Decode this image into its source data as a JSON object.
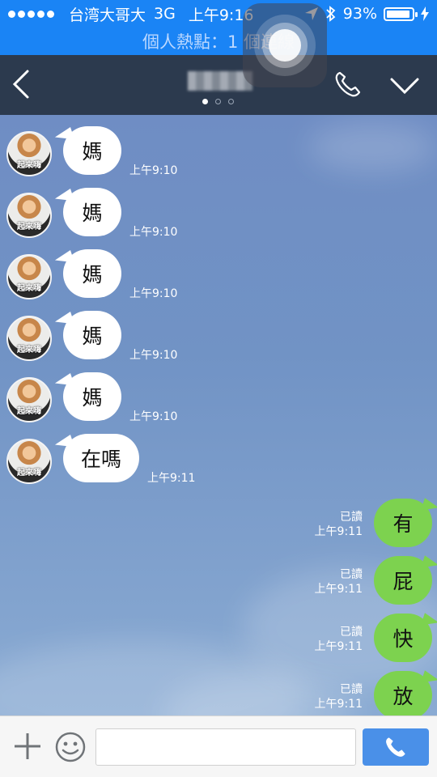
{
  "status_bar": {
    "carrier": "台湾大哥大",
    "network": "3G",
    "time": "上午9:16",
    "battery_percent": "93%",
    "battery_level": 0.93
  },
  "hotspot_bar": {
    "text": "個人熱點：1 個連線"
  },
  "header": {
    "page_count": 3,
    "active_page": 1
  },
  "incoming": [
    {
      "text": "媽",
      "time": "上午9:10",
      "avatar_caption": "起來嗨"
    },
    {
      "text": "媽",
      "time": "上午9:10",
      "avatar_caption": "起來嗨"
    },
    {
      "text": "媽",
      "time": "上午9:10",
      "avatar_caption": "起來嗨"
    },
    {
      "text": "媽",
      "time": "上午9:10",
      "avatar_caption": "起來嗨"
    },
    {
      "text": "媽",
      "time": "上午9:10",
      "avatar_caption": "起來嗨"
    },
    {
      "text": "在嗎",
      "time": "上午9:11",
      "avatar_caption": "起來嗨"
    }
  ],
  "outgoing": [
    {
      "text": "有",
      "read": "已讀",
      "time": "上午9:11"
    },
    {
      "text": "屁",
      "read": "已讀",
      "time": "上午9:11"
    },
    {
      "text": "快",
      "read": "已讀",
      "time": "上午9:11"
    },
    {
      "text": "放",
      "read": "已讀",
      "time": "上午9:11"
    }
  ],
  "input": {
    "placeholder": ""
  },
  "colors": {
    "status_bar": "#1a84f5",
    "header": "#2c3a4e",
    "outgoing_bubble": "#7dd24f",
    "incoming_bubble": "#ffffff",
    "call_button": "#4a90e8"
  },
  "icons": [
    "back-arrow-icon",
    "phone-icon",
    "chevron-down-icon",
    "plus-icon",
    "emoji-icon",
    "phone-icon",
    "location-arrow-icon",
    "bluetooth-icon",
    "battery-icon",
    "charging-icon"
  ]
}
